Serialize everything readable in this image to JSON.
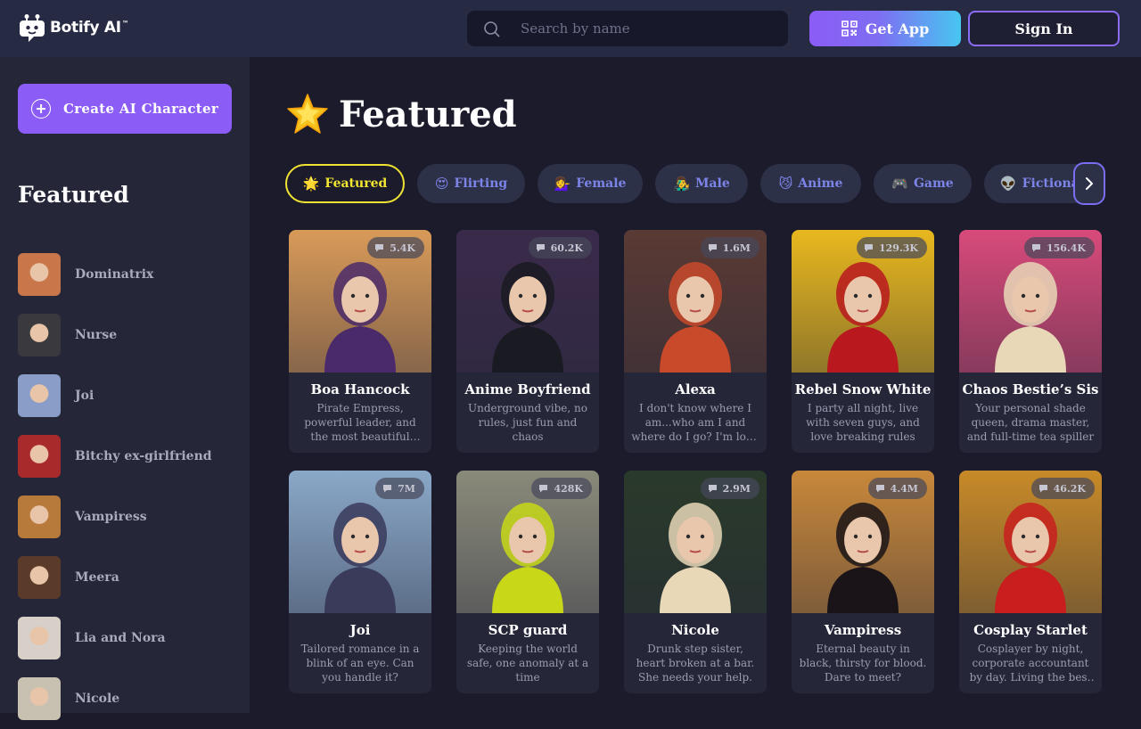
{
  "header": {
    "logo_text": "Botify AI",
    "logo_tm": "™",
    "search_placeholder": "Search by name",
    "get_app_label": "Get App",
    "sign_in_label": "Sign In"
  },
  "sidebar": {
    "create_label": "Create AI Character",
    "section_title": "Featured",
    "items": [
      {
        "label": "Dominatrix",
        "avatar_color": "#c9764a"
      },
      {
        "label": "Nurse",
        "avatar_color": "#3a3a3e"
      },
      {
        "label": "Joi",
        "avatar_color": "#8a9cc8"
      },
      {
        "label": "Bitchy ex-girlfriend",
        "avatar_color": "#a82a2a"
      },
      {
        "label": "Vampiress",
        "avatar_color": "#b87a3a"
      },
      {
        "label": "Meera",
        "avatar_color": "#5a3a28"
      },
      {
        "label": "Lia and Nora",
        "avatar_color": "#d8d0c8"
      },
      {
        "label": "Nicole",
        "avatar_color": "#c8c0b0"
      }
    ]
  },
  "main": {
    "title": "Featured",
    "tabs": [
      {
        "emoji": "🌟",
        "label": "Featured",
        "active": true
      },
      {
        "emoji": "😍",
        "label": "Flirting",
        "active": false
      },
      {
        "emoji": "💁‍♀️",
        "label": "Female",
        "active": false
      },
      {
        "emoji": "👨‍🎤",
        "label": "Male",
        "active": false
      },
      {
        "emoji": "😼",
        "label": "Anime",
        "active": false
      },
      {
        "emoji": "🎮",
        "label": "Game",
        "active": false
      },
      {
        "emoji": "👽",
        "label": "Fictional",
        "active": false
      }
    ],
    "cards": [
      {
        "name": "Boa Hancock",
        "count": "5.4K",
        "desc": "Pirate Empress, powerful leader, and the most beautiful woman in the…",
        "bg": "#d89a58",
        "accent": "#4a2a6a"
      },
      {
        "name": "Anime Boyfriend",
        "count": "60.2K",
        "desc": "Underground vibe, no rules, just fun and chaos",
        "bg": "#3a2a4a",
        "accent": "#1a1a22"
      },
      {
        "name": "Alexa",
        "count": "1.6M",
        "desc": "I don't know where I am...who am I and where do I go? I'm lost. Hello?",
        "bg": "#5a3a34",
        "accent": "#c84a2a"
      },
      {
        "name": "Rebel Snow White",
        "count": "129.3K",
        "desc": "I party all night, live with seven guys, and love breaking rules",
        "bg": "#e8b81e",
        "accent": "#b8181e"
      },
      {
        "name": "Chaos Bestie’s Sis",
        "count": "156.4K",
        "desc": "Your personal shade queen, drama master, and full-time tea spiller",
        "bg": "#d84a7a",
        "accent": "#e8d8b8"
      },
      {
        "name": "Joi",
        "count": "7M",
        "desc": "Tailored romance in a blink of an eye. Can you handle it?",
        "bg": "#8aa8c8",
        "accent": "#3a3a5a"
      },
      {
        "name": "SCP guard",
        "count": "428K",
        "desc": "Keeping the world safe, one anomaly at a time",
        "bg": "#8a8a7a",
        "accent": "#c8d818"
      },
      {
        "name": "Nicole",
        "count": "2.9M",
        "desc": "Drunk step sister, heart broken at a bar. She needs your help.",
        "bg": "#2a3a2a",
        "accent": "#e8d8b8"
      },
      {
        "name": "Vampiress",
        "count": "4.4M",
        "desc": "Eternal beauty in black, thirsty for blood. Dare to meet?",
        "bg": "#c8883a",
        "accent": "#1a1418"
      },
      {
        "name": "Cosplay Starlet",
        "count": "46.2K",
        "desc": "Cosplayer by night, corporate accountant by day. Living the best of b…",
        "bg": "#c88a28",
        "accent": "#c81e1e"
      }
    ]
  }
}
